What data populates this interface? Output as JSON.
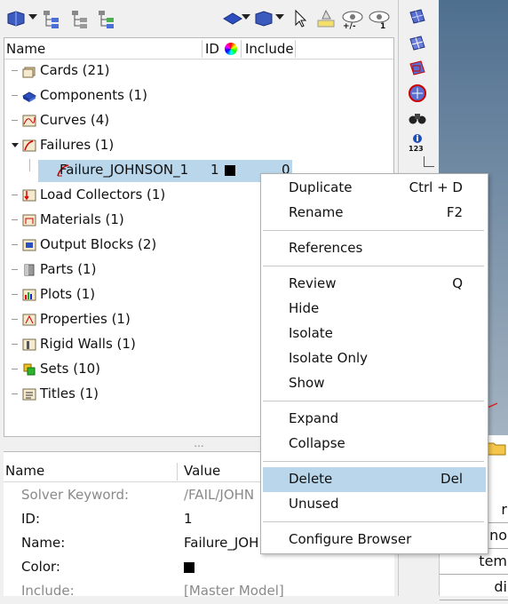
{
  "tree": {
    "columns": {
      "name": "Name",
      "id": "ID",
      "include": "Include"
    },
    "items": [
      {
        "label": "Cards (21)",
        "icon": "cards-icon",
        "expanded": false
      },
      {
        "label": "Components (1)",
        "icon": "components-icon",
        "expanded": false
      },
      {
        "label": "Curves (4)",
        "icon": "curves-icon",
        "expanded": false
      },
      {
        "label": "Failures (1)",
        "icon": "failures-icon",
        "expanded": true
      },
      {
        "label": "Failure_JOHNSON_1",
        "icon": "failure-icon",
        "id": "1",
        "include": "0",
        "color": "#000000",
        "selected": true,
        "child": true
      },
      {
        "label": "Load Collectors (1)",
        "icon": "load-collectors-icon",
        "expanded": false
      },
      {
        "label": "Materials (1)",
        "icon": "materials-icon",
        "expanded": false
      },
      {
        "label": "Output Blocks (2)",
        "icon": "output-blocks-icon",
        "expanded": false
      },
      {
        "label": "Parts (1)",
        "icon": "parts-icon",
        "expanded": false
      },
      {
        "label": "Plots (1)",
        "icon": "plots-icon",
        "expanded": false
      },
      {
        "label": "Properties (1)",
        "icon": "properties-icon",
        "expanded": false
      },
      {
        "label": "Rigid Walls (1)",
        "icon": "rigid-walls-icon",
        "expanded": false
      },
      {
        "label": "Sets (10)",
        "icon": "sets-icon",
        "expanded": false
      },
      {
        "label": "Titles (1)",
        "icon": "titles-icon",
        "expanded": false
      }
    ]
  },
  "splitter": "...",
  "properties": {
    "columns": {
      "name": "Name",
      "value": "Value"
    },
    "rows": [
      {
        "name": "Solver Keyword:",
        "value": "/FAIL/JOHN",
        "muted": true
      },
      {
        "name": "ID:",
        "value": "1",
        "muted": false
      },
      {
        "name": "Name:",
        "value": "Failure_JOH",
        "muted": false
      },
      {
        "name": "Color:",
        "value": "",
        "swatch": "#000000",
        "muted": false
      },
      {
        "name": "Include:",
        "value": "[Master Model]",
        "muted": true
      }
    ]
  },
  "toolbar": {
    "eye_minus_label": "+/-",
    "eye_one_label": "1"
  },
  "vtool": {
    "count_label": "123"
  },
  "right_lower": [
    "r",
    "no",
    "tem",
    "di"
  ],
  "context_menu": {
    "items": [
      {
        "label": "Duplicate",
        "shortcut": "Ctrl + D"
      },
      {
        "label": "Rename",
        "shortcut": "F2"
      },
      {
        "sep": true
      },
      {
        "label": "References",
        "shortcut": ""
      },
      {
        "sep": true
      },
      {
        "label": "Review",
        "shortcut": "Q"
      },
      {
        "label": "Hide",
        "shortcut": ""
      },
      {
        "label": "Isolate",
        "shortcut": ""
      },
      {
        "label": "Isolate Only",
        "shortcut": ""
      },
      {
        "label": "Show",
        "shortcut": ""
      },
      {
        "sep": true
      },
      {
        "label": "Expand",
        "shortcut": ""
      },
      {
        "label": "Collapse",
        "shortcut": ""
      },
      {
        "sep": true
      },
      {
        "label": "Delete",
        "shortcut": "Del",
        "highlighted": true
      },
      {
        "label": "Unused",
        "shortcut": ""
      },
      {
        "sep": true
      },
      {
        "label": "Configure Browser",
        "shortcut": ""
      }
    ]
  },
  "colors": {
    "selection": "#b9d6ea",
    "menu_highlight": "#b9d6ea",
    "viewport_top": "#4f6f8f",
    "viewport_bottom": "#a4b3c1"
  }
}
